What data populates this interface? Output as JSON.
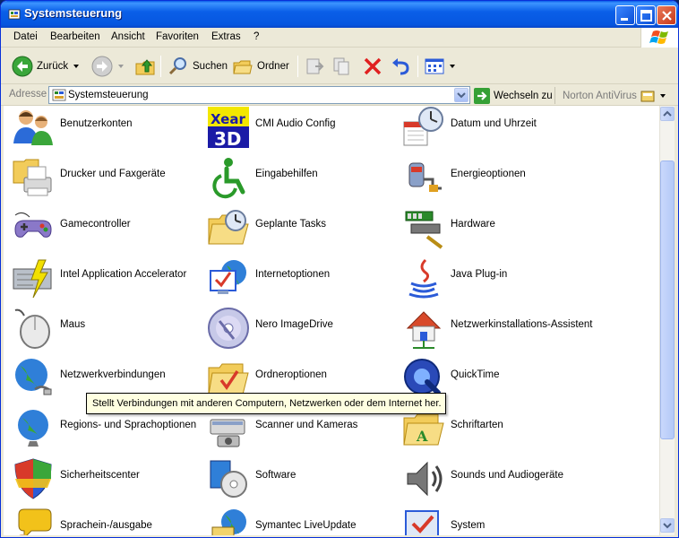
{
  "window": {
    "title": "Systemsteuerung"
  },
  "menu": {
    "items": [
      {
        "label": "Datei"
      },
      {
        "label": "Bearbeiten"
      },
      {
        "label": "Ansicht"
      },
      {
        "label": "Favoriten"
      },
      {
        "label": "Extras"
      },
      {
        "label": "?"
      }
    ]
  },
  "toolbar": {
    "back_label": "Zurück",
    "search_label": "Suchen",
    "folders_label": "Ordner"
  },
  "address": {
    "label": "Adresse",
    "value": "Systemsteuerung",
    "go_label": "Wechseln zu",
    "norton_label": "Norton AntiVirus"
  },
  "items": [
    {
      "label": "Benutzerkonten",
      "icon": "users-icon"
    },
    {
      "label": "CMI Audio Config",
      "icon": "cmi-audio-icon"
    },
    {
      "label": "Datum und Uhrzeit",
      "icon": "clock-calendar-icon"
    },
    {
      "label": "Drucker und Faxgeräte",
      "icon": "printer-icon"
    },
    {
      "label": "Eingabehilfen",
      "icon": "accessibility-icon"
    },
    {
      "label": "Energieoptionen",
      "icon": "power-plug-icon"
    },
    {
      "label": "Gamecontroller",
      "icon": "gamepad-icon"
    },
    {
      "label": "Geplante Tasks",
      "icon": "scheduled-tasks-icon"
    },
    {
      "label": "Hardware",
      "icon": "hardware-icon"
    },
    {
      "label": "Intel Application Accelerator",
      "icon": "intel-accelerator-icon"
    },
    {
      "label": "Internetoptionen",
      "icon": "internet-options-icon"
    },
    {
      "label": "Java Plug-in",
      "icon": "java-icon"
    },
    {
      "label": "Maus",
      "icon": "mouse-icon"
    },
    {
      "label": "Nero ImageDrive",
      "icon": "disc-icon"
    },
    {
      "label": "Netzwerkinstallations-Assistent",
      "icon": "network-house-icon"
    },
    {
      "label": "Netzwerkverbindungen",
      "icon": "network-globe-icon"
    },
    {
      "label": "Ordneroptionen",
      "icon": "folder-options-icon"
    },
    {
      "label": "QuickTime",
      "icon": "quicktime-icon"
    },
    {
      "label": "Regions- und Sprachoptionen",
      "icon": "globe-icon"
    },
    {
      "label": "Scanner und Kameras",
      "icon": "scanner-camera-icon"
    },
    {
      "label": "Schriftarten",
      "icon": "fonts-folder-icon"
    },
    {
      "label": "Sicherheitscenter",
      "icon": "security-shield-icon"
    },
    {
      "label": "Software",
      "icon": "software-icon"
    },
    {
      "label": "Sounds und Audiogeräte",
      "icon": "speaker-icon"
    },
    {
      "label": "Sprachein-/ausgabe",
      "icon": "speech-icon"
    },
    {
      "label": "Symantec LiveUpdate",
      "icon": "liveupdate-icon"
    },
    {
      "label": "System",
      "icon": "system-icon"
    }
  ],
  "tooltip": {
    "text": "Stellt Verbindungen mit anderen Computern, Netzwerken oder dem Internet her."
  },
  "colors": {
    "titlebar": "#0a5fe8",
    "menubar": "#ece9d8",
    "content_bg": "#ffffff",
    "tooltip_bg": "#ffffe1"
  }
}
